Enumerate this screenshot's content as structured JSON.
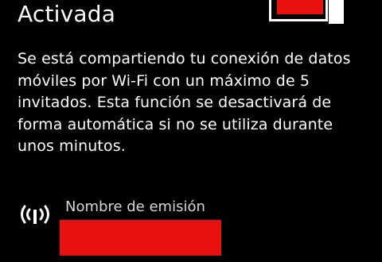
{
  "hotspot": {
    "status": "Activada",
    "toggle_on": true,
    "description": "Se está compartiendo tu conexión de datos móviles por Wi-Fi con un máximo de 5 invitados. Esta función se desactivará de forma automática si no se utiliza durante unos minutos.",
    "broadcast_icon": "wifi-broadcast-icon",
    "broadcast_label": "Nombre de emisión"
  },
  "colors": {
    "accent": "#e8110f",
    "background": "#000000",
    "text": "#ffffff",
    "secondary_text": "#d6d6d6"
  }
}
